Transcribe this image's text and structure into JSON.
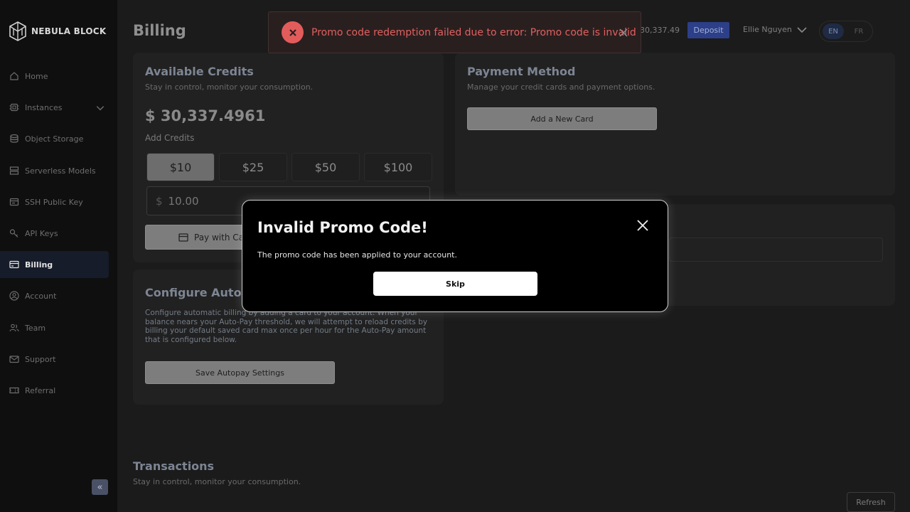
{
  "brand": {
    "name": "NEBULA BLOCK"
  },
  "sidebar": {
    "items": [
      {
        "label": "Home",
        "icon": "home-icon"
      },
      {
        "label": "Instances",
        "icon": "chip-icon"
      },
      {
        "label": "Object Storage",
        "icon": "database-icon"
      },
      {
        "label": "Serverless Models",
        "icon": "server-icon"
      },
      {
        "label": "SSH Public Key",
        "icon": "key-card-icon"
      },
      {
        "label": "API Keys",
        "icon": "key-icon"
      },
      {
        "label": "Billing",
        "icon": "credit-card-icon",
        "active": true
      },
      {
        "label": "Account",
        "icon": "user-circle-icon"
      },
      {
        "label": "Team",
        "icon": "team-icon"
      },
      {
        "label": "Support",
        "icon": "mail-icon"
      },
      {
        "label": "Referral",
        "icon": "ticket-icon"
      }
    ],
    "collapse_label": "«"
  },
  "header": {
    "title": "Billing",
    "balance": "30,337.49",
    "deposit_label": "Deposit",
    "user_name": "Ellie Nguyen",
    "languages": [
      "EN",
      "FR"
    ]
  },
  "credits": {
    "title": "Available Credits",
    "subtitle": "Stay in control, monitor your consumption.",
    "balance": "$ 30,337.4961",
    "add_label": "Add Credits",
    "amounts": [
      "$10",
      "$25",
      "$50",
      "$100"
    ],
    "currency_symbol": "$",
    "input_value": "10.00",
    "pay_label": "Pay with Ca"
  },
  "payment": {
    "title": "Payment Method",
    "subtitle": "Manage your credit cards and payment options.",
    "add_card_label": "Add a New Card"
  },
  "autopay": {
    "title": "Configure Auto-P",
    "description": "Configure automatic billing by adding a card to your account. When your balance nears your Auto-Pay threshold, we will attempt to reload credits by billing your default saved card max once per hour for the Auto-Pay amount that is configured below.",
    "save_label": "Save Autopay Settings"
  },
  "transactions": {
    "title": "Transactions",
    "subtitle": "Stay in control, monitor your consumption.",
    "refresh_label": "Refresh"
  },
  "toast": {
    "message": "Promo code redemption failed due to error: Promo code is invalid"
  },
  "modal": {
    "title": "Invalid Promo Code!",
    "body": "The promo code has been applied to your account.",
    "skip_label": "Skip"
  },
  "colors": {
    "accent": "#2c3f88",
    "error": "#e25c5c",
    "sidebar_active": "#161c29"
  }
}
